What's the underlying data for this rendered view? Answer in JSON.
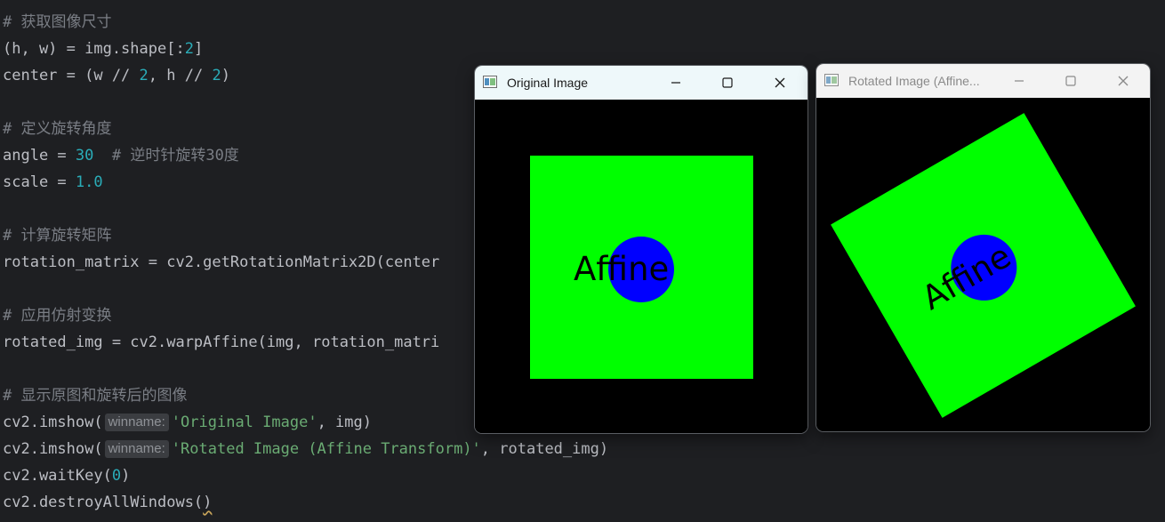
{
  "code": {
    "lines": [
      {
        "t": "cmt",
        "text": "# 获取图像尺寸"
      },
      {
        "t": "code",
        "parts": [
          [
            "",
            "(h, w) = img.shape[:"
          ],
          [
            "num",
            "2"
          ],
          [
            "",
            "]"
          ]
        ]
      },
      {
        "t": "code",
        "parts": [
          [
            "",
            "center = (w // "
          ],
          [
            "num",
            "2"
          ],
          [
            "",
            ", h // "
          ],
          [
            "num",
            "2"
          ],
          [
            "",
            ")"
          ]
        ]
      },
      {
        "t": "blank"
      },
      {
        "t": "cmt",
        "text": "# 定义旋转角度"
      },
      {
        "t": "code",
        "parts": [
          [
            "",
            "angle = "
          ],
          [
            "num",
            "30"
          ],
          [
            "",
            "  "
          ],
          [
            "cmt",
            "# 逆时针旋转30度"
          ]
        ]
      },
      {
        "t": "code",
        "parts": [
          [
            "",
            "scale = "
          ],
          [
            "num",
            "1.0"
          ]
        ]
      },
      {
        "t": "blank"
      },
      {
        "t": "cmt",
        "text": "# 计算旋转矩阵"
      },
      {
        "t": "code",
        "parts": [
          [
            "",
            "rotation_matrix = cv2.getRotationMatrix2D(center"
          ]
        ]
      },
      {
        "t": "blank"
      },
      {
        "t": "cmt",
        "text": "# 应用仿射变换"
      },
      {
        "t": "code",
        "parts": [
          [
            "",
            "rotated_img = cv2.warpAffine(img, rotation_matri"
          ]
        ]
      },
      {
        "t": "blank"
      },
      {
        "t": "cmt",
        "text": "# 显示原图和旋转后的图像"
      },
      {
        "t": "code",
        "parts": [
          [
            "",
            "cv2.imshow("
          ],
          [
            "hint",
            "winname:"
          ],
          [
            "str",
            "'Original Image'"
          ],
          [
            "",
            ", img)"
          ]
        ]
      },
      {
        "t": "code",
        "parts": [
          [
            "",
            "cv2.imshow("
          ],
          [
            "hint",
            "winname:"
          ],
          [
            "str",
            "'Rotated Image (Affine Transform)'"
          ],
          [
            "",
            ", rotated_img)"
          ]
        ]
      },
      {
        "t": "code",
        "parts": [
          [
            "",
            "cv2.waitKey("
          ],
          [
            "num",
            "0"
          ],
          [
            "",
            ")"
          ]
        ]
      },
      {
        "t": "code",
        "parts": [
          [
            "",
            "cv2.destroyAllWindows("
          ],
          [
            "squiggle",
            ")"
          ]
        ]
      }
    ]
  },
  "windows": {
    "original": {
      "title": "Original Image",
      "image_text": "Affine"
    },
    "rotated": {
      "title": "Rotated Image (Affine...",
      "image_text": "Affine",
      "rotation_deg": 30
    }
  },
  "icons": {
    "minimize": "minimize-icon",
    "maximize": "maximize-icon",
    "close": "close-icon",
    "app": "opencv-window-icon"
  },
  "colors": {
    "editor_bg": "#1e1f22",
    "square": "#00ff00",
    "circle": "#0000ff",
    "image_bg": "#000000",
    "text": "#000000"
  }
}
